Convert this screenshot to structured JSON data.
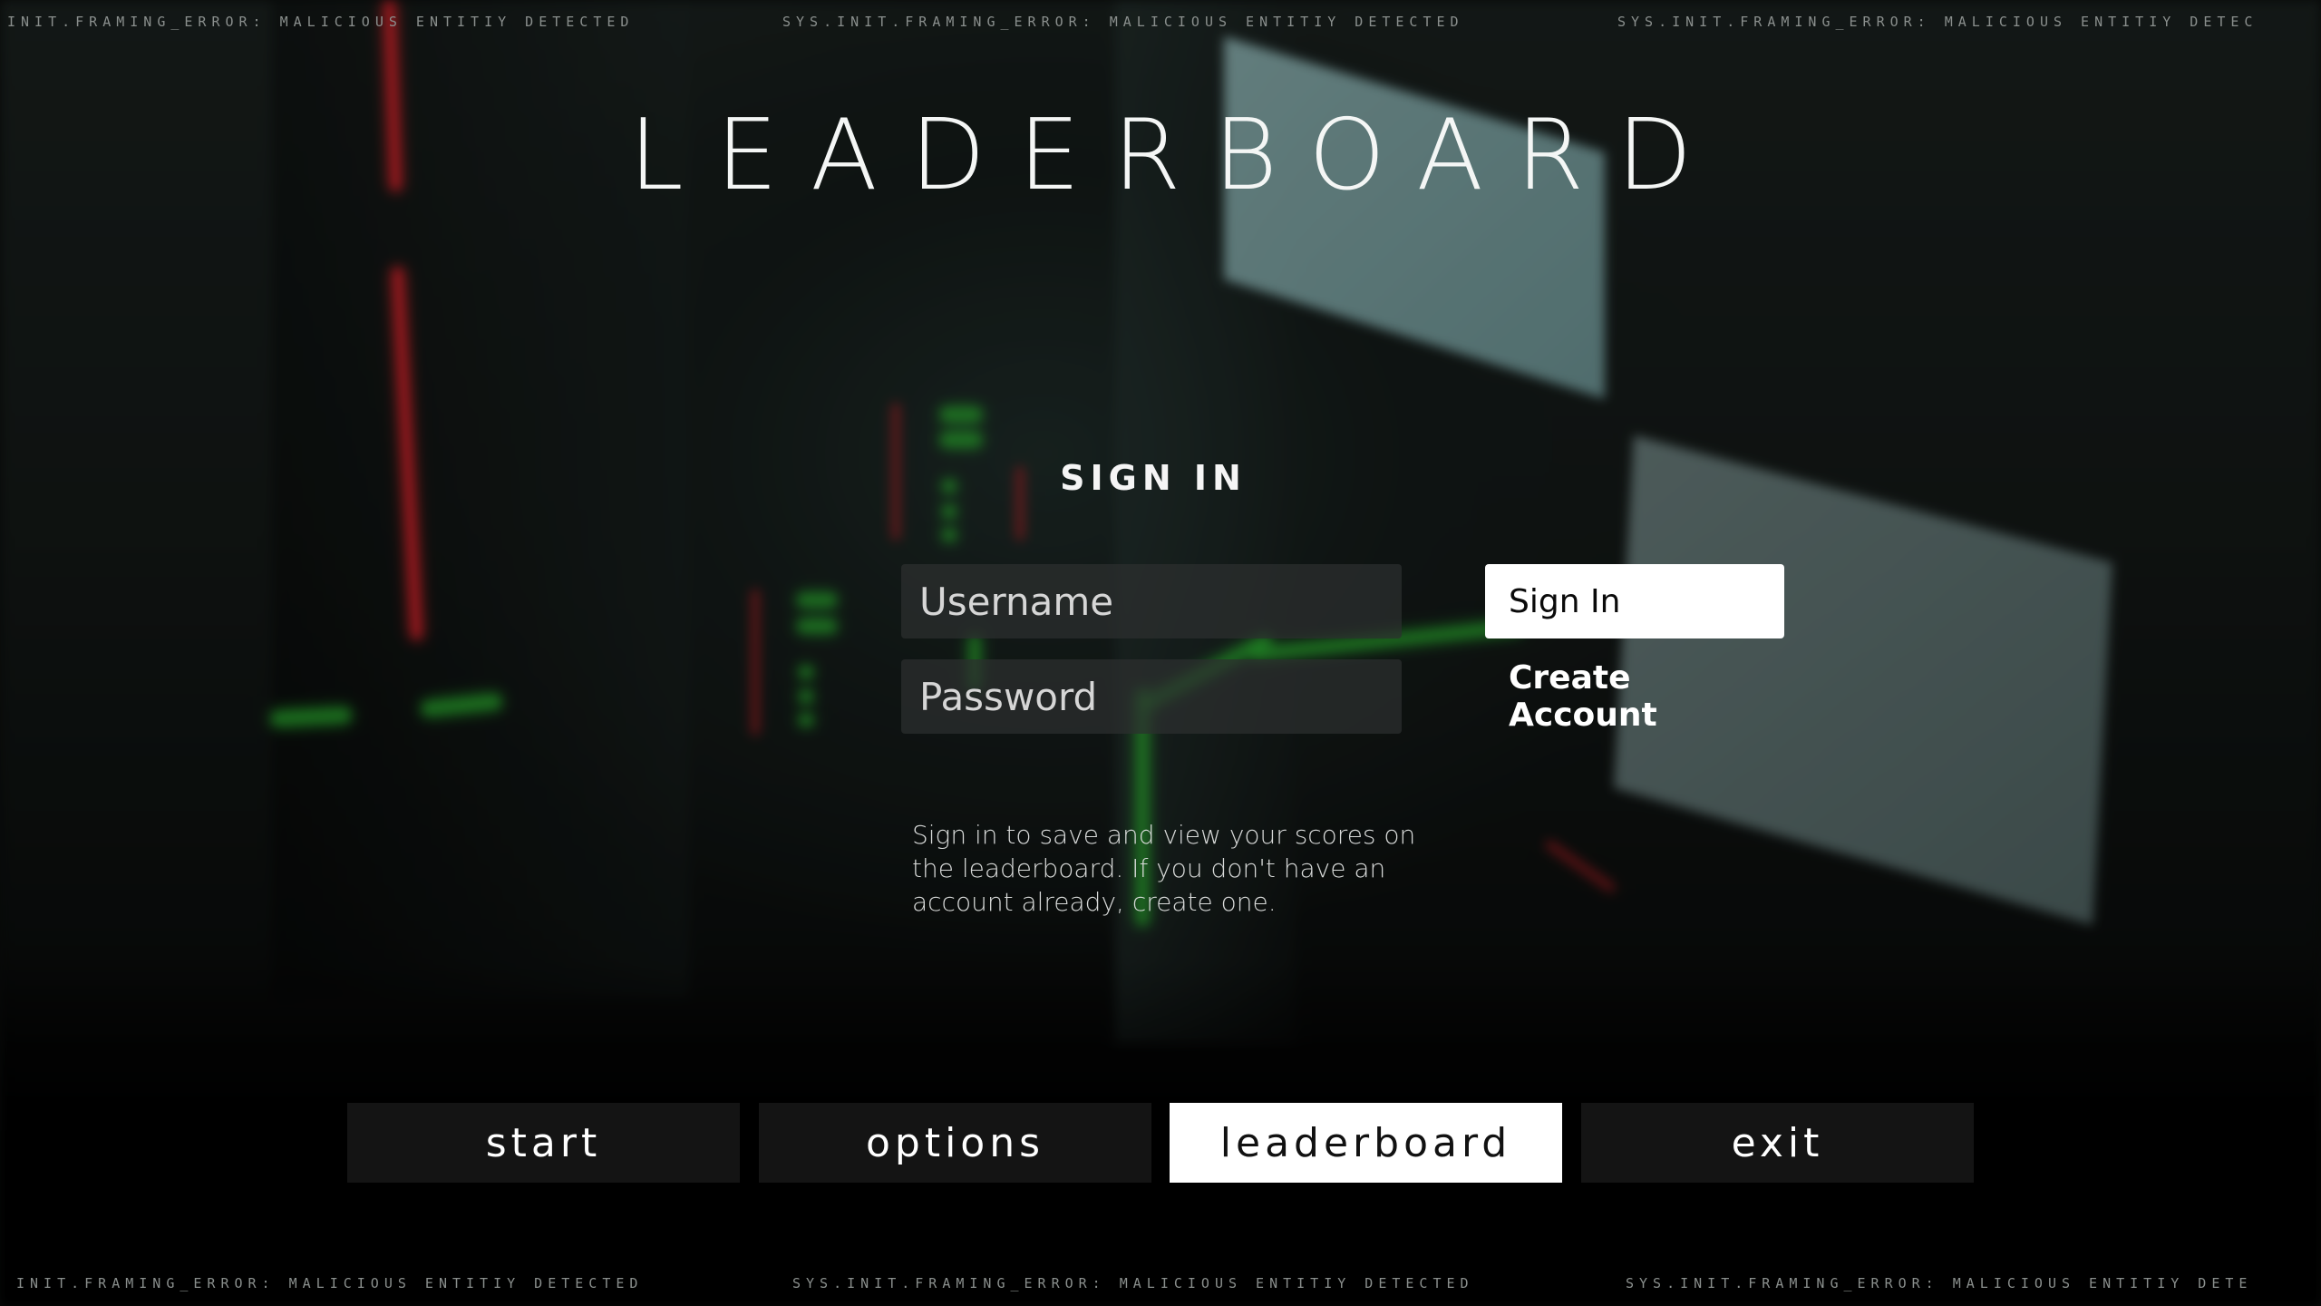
{
  "ticker": {
    "top": [
      "INIT.FRAMING_ERROR: MALICIOUS ENTITIY DETECTED",
      "SYS.INIT.FRAMING_ERROR: MALICIOUS ENTITIY DETECTED",
      "SYS.INIT.FRAMING_ERROR: MALICIOUS ENTITIY DETEC"
    ],
    "bottom": [
      "INIT.FRAMING_ERROR: MALICIOUS ENTITIY DETECTED",
      "SYS.INIT.FRAMING_ERROR: MALICIOUS ENTITIY DETECTED",
      "SYS.INIT.FRAMING_ERROR: MALICIOUS ENTITIY DETE"
    ]
  },
  "page": {
    "title": "LEADERBOARD"
  },
  "signin": {
    "heading": "SIGN IN",
    "username_placeholder": "Username",
    "username_value": "",
    "password_placeholder": "Password",
    "password_value": "",
    "signin_label": "Sign In",
    "create_label": "Create Account",
    "help_text": "Sign in to save and view your scores on the leaderboard. If you don't have an account already, create one."
  },
  "nav": {
    "items": [
      {
        "label": "start",
        "active": false
      },
      {
        "label": "options",
        "active": false
      },
      {
        "label": "leaderboard",
        "active": true
      },
      {
        "label": "exit",
        "active": false
      }
    ]
  },
  "colors": {
    "accent_active_bg": "#ffffff",
    "nav_bg": "#161616",
    "laser_red": "#d8222b",
    "glow_green": "#2fbf33",
    "ticker_text": "#8a8f8d"
  }
}
